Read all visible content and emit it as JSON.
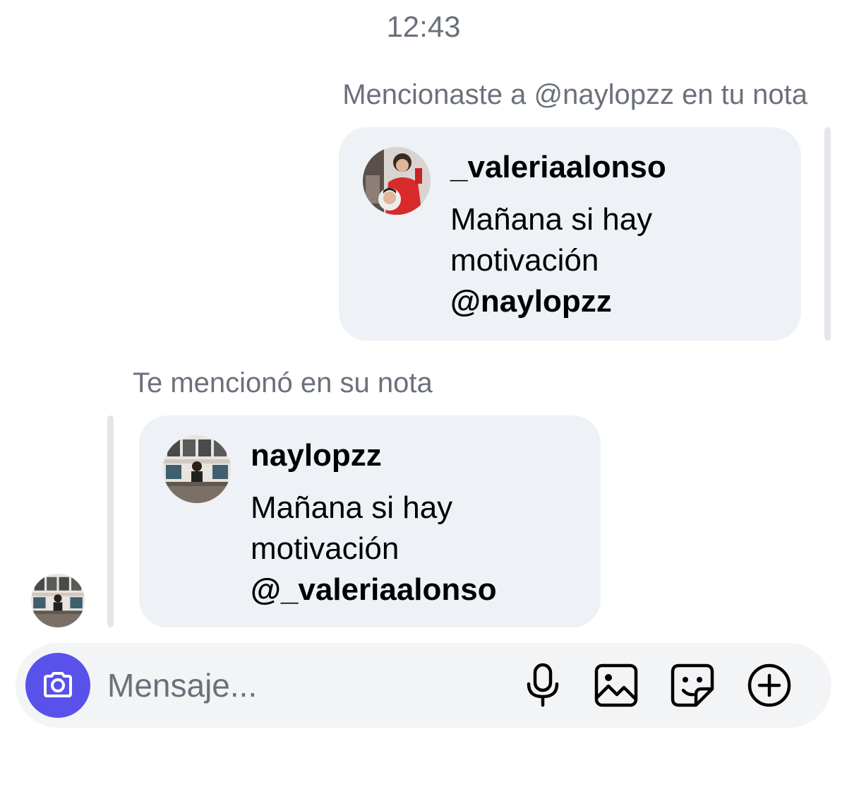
{
  "timestamp": "12:43",
  "outgoing_note": {
    "caption": "Mencionaste a @naylopzz en tu nota",
    "username": "_valeriaalonso",
    "text_lines": [
      "Mañana si hay",
      "motivación"
    ],
    "mention": "@naylopzz"
  },
  "incoming_note": {
    "caption": "Te mencionó en su nota",
    "username": "naylopzz",
    "text_lines": [
      "Mañana si hay",
      "motivación"
    ],
    "mention": "@_valeriaalonso"
  },
  "composer": {
    "placeholder": "Mensaje...",
    "accent_color": "#5851ea",
    "icons": [
      "camera-icon",
      "microphone-icon",
      "gallery-icon",
      "sticker-icon",
      "plus-icon"
    ]
  }
}
